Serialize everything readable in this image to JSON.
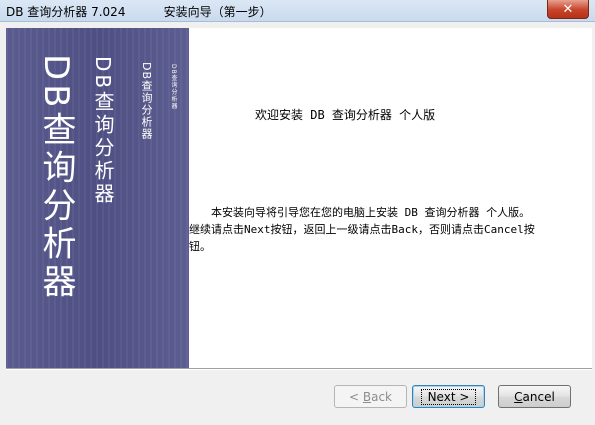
{
  "window": {
    "title": "DB 查询分析器 7.024          安装向导（第一步）",
    "close_glyph": "✕"
  },
  "banner": {
    "line_big_latin": "DB",
    "line_big_cjk": "查询分析器",
    "line_mid_latin": "DB",
    "line_mid_cjk": "查询分析器",
    "line_small_latin": "DB",
    "line_small_cjk": "查询分析器",
    "line_tiny_latin": "DB",
    "line_tiny_cjk": "查询分析器"
  },
  "content": {
    "welcome": "欢迎安装 DB 查询分析器 个人版",
    "description": "本安装向导将引导您在您的电脑上安装 DB 查询分析器 个人版。继续请点击Next按钮，返回上一级请点击Back，否则请点击Cancel按钮。"
  },
  "buttons": {
    "back": {
      "prefix": "< ",
      "accel": "B",
      "rest": "ack"
    },
    "next": {
      "label": "Next >"
    },
    "cancel": {
      "accel": "C",
      "rest": "ancel"
    }
  },
  "colors": {
    "banner": "#55568a",
    "close_button": "#c7432a"
  }
}
